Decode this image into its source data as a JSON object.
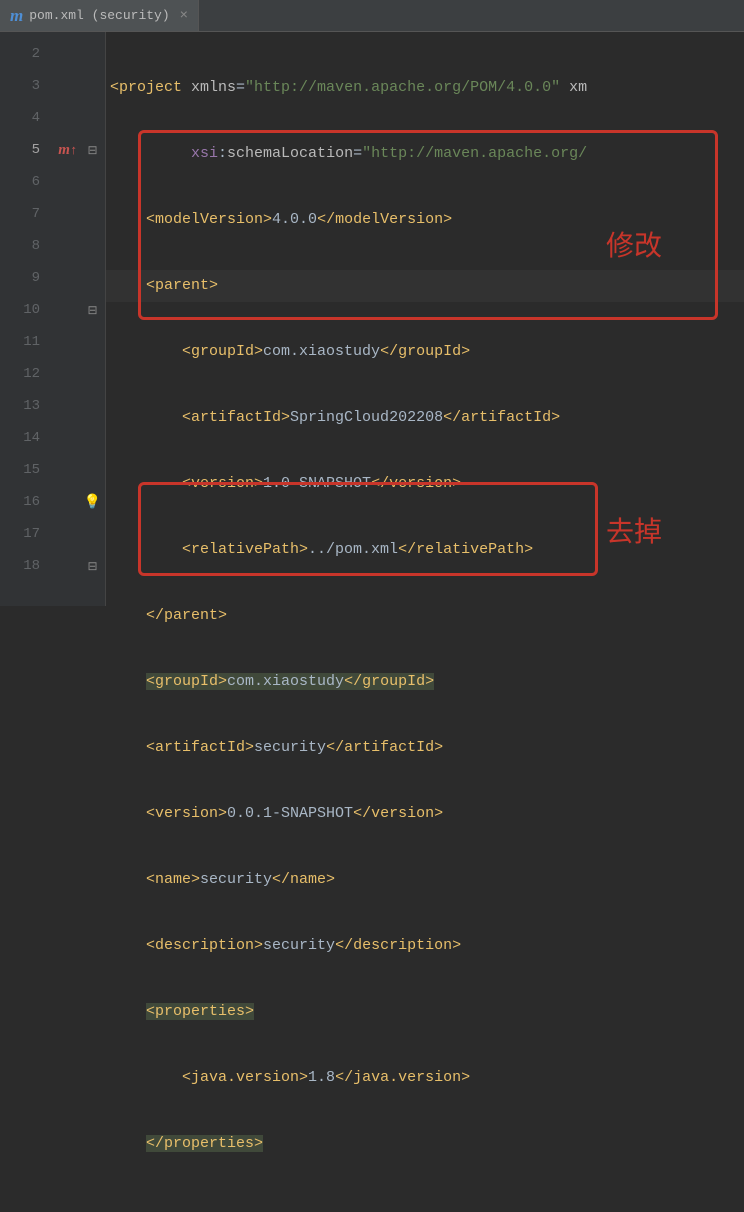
{
  "tab": {
    "icon": "m",
    "label": "pom.xml (security)",
    "close": "×"
  },
  "gutter": {
    "lines": [
      "2",
      "3",
      "4",
      "5",
      "6",
      "7",
      "8",
      "9",
      "10",
      "11",
      "12",
      "13",
      "14",
      "15",
      "16",
      "17",
      "18"
    ],
    "current": "5"
  },
  "code": {
    "l2": {
      "open": "<project ",
      "attr": "xmlns",
      "eq": "=",
      "val": "\"http://maven.apache.org/POM/4.0.0\"",
      "tail": " xm"
    },
    "l3": {
      "ns": "xsi",
      "colon": ":",
      "attr": "schemaLocation",
      "eq": "=",
      "val": "\"http://maven.apache.org/"
    },
    "l4": {
      "open": "<modelVersion>",
      "txt": "4.0.0",
      "close": "</modelVersion>"
    },
    "l5": {
      "open": "<parent>"
    },
    "l6": {
      "open": "<groupId>",
      "txt": "com.xiaostudy",
      "close": "</groupId>"
    },
    "l7": {
      "open": "<artifactId>",
      "txt": "SpringCloud202208",
      "close": "</artifactId>"
    },
    "l8": {
      "open": "<version>",
      "txt": "1.0-SNAPSHOT",
      "close": "</version>"
    },
    "l9": {
      "open": "<relativePath>",
      "txt": "../pom.xml",
      "close": "</relativePath>"
    },
    "l10": {
      "close": "</parent>"
    },
    "l11": {
      "open": "<groupId>",
      "txt": "com.xiaostudy",
      "close": "</groupId>"
    },
    "l12": {
      "open": "<artifactId>",
      "txt": "security",
      "close": "</artifactId>"
    },
    "l13": {
      "open": "<version>",
      "txt": "0.0.1-SNAPSHOT",
      "close": "</version>"
    },
    "l14": {
      "open": "<name>",
      "txt": "security",
      "close": "</name>"
    },
    "l15": {
      "open": "<description>",
      "txt": "security",
      "close": "</description>"
    },
    "l16": {
      "open": "<properties>"
    },
    "l17": {
      "open": "<java.version>",
      "txt": "1.8",
      "close": "</java.version>"
    },
    "l18": {
      "close": "</properties>"
    }
  },
  "annotations": {
    "box1_label": "修改",
    "box2_label": "去掉"
  }
}
